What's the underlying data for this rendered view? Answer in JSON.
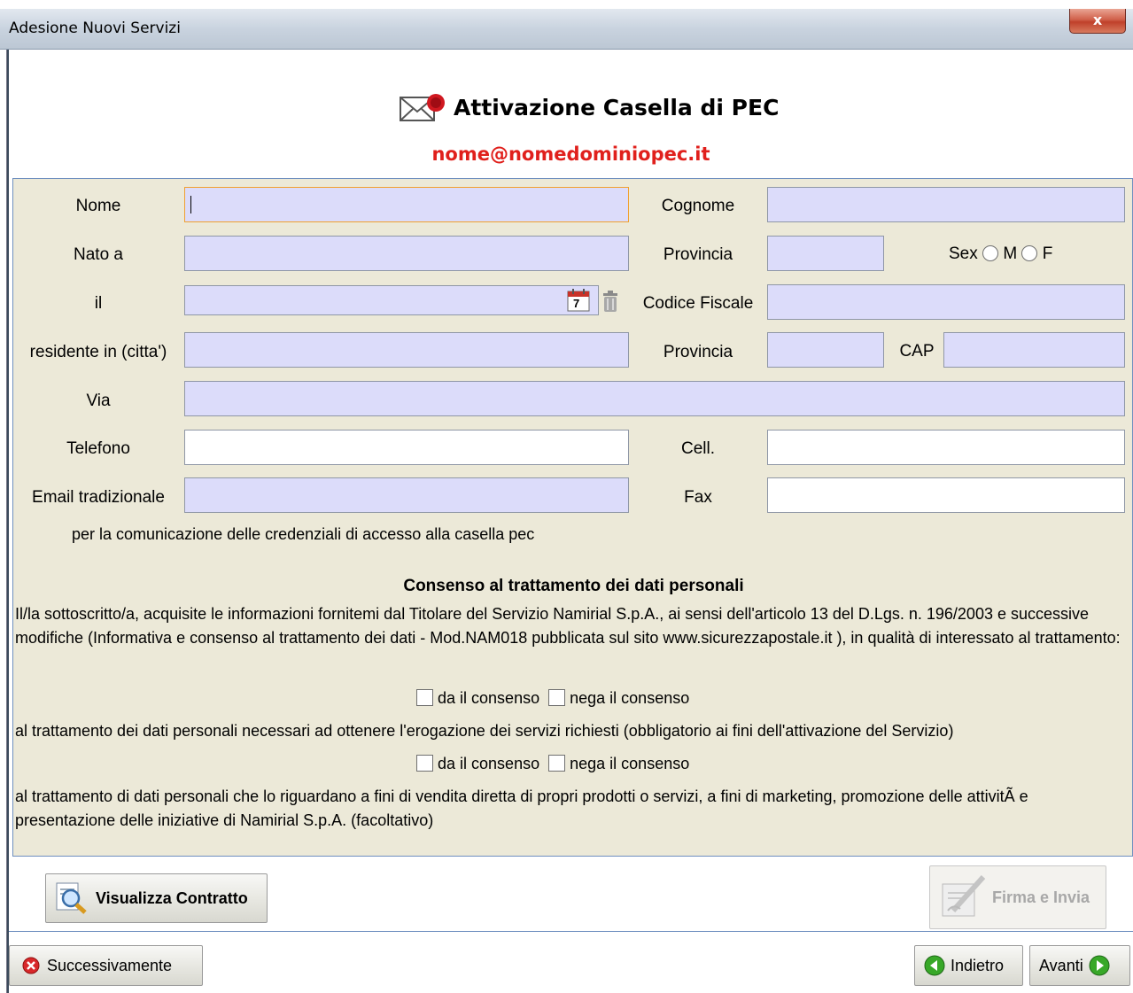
{
  "window": {
    "title": "Adesione Nuovi Servizi",
    "close_glyph": "x"
  },
  "header": {
    "title": "Attivazione Casella di PEC",
    "email": "nome@nomedominiopec.it",
    "icon": "mail-seal-icon"
  },
  "form": {
    "nome_label": "Nome",
    "nome_value": "",
    "cognome_label": "Cognome",
    "nato_label": "Nato a",
    "provincia1_label": "Provincia",
    "sex_label": "Sex",
    "sex_m": "M",
    "sex_f": "F",
    "il_label": "il",
    "calendar_day": "7",
    "codice_fiscale_label": "Codice Fiscale",
    "residente_label": "residente in (citta')",
    "provincia2_label": "Provincia",
    "cap_label": "CAP",
    "via_label": "Via",
    "telefono_label": "Telefono",
    "cell_label": "Cell.",
    "email_label": "Email tradizionale",
    "fax_label": "Fax",
    "email_note": "per la comunicazione delle credenziali di accesso alla casella pec"
  },
  "consent": {
    "heading": "Consenso al trattamento dei dati personali",
    "intro": "Il/la sottoscritto/a, acquisite le informazioni fornitemi dal Titolare del Servizio Namirial S.p.A., ai sensi dell'articolo 13 del D.Lgs. n. 196/2003 e successive modifiche (Informativa e consenso al trattamento dei dati - Mod.NAM018 pubblicata sul sito www.sicurezzapostale.it ), in qualità di interessato al trattamento:",
    "give1": "da il consenso",
    "deny1": "nega il consenso",
    "text1": "al trattamento dei dati personali necessari ad ottenere l'erogazione dei servizi richiesti (obbligatorio ai fini dell'attivazione del Servizio)",
    "give2": "da il consenso",
    "deny2": "nega il consenso",
    "text2": "al trattamento di dati personali che lo riguardano a fini di vendita diretta di propri prodotti o servizi, a fini di marketing, promozione delle attivitÃ  e presentazione delle iniziative di Namirial S.p.A. (facoltativo)"
  },
  "buttons": {
    "view_contract": "Visualizza Contratto",
    "sign_send": "Firma e Invia",
    "later": "Successivamente",
    "back": "Indietro",
    "next": "Avanti"
  },
  "colors": {
    "accent_red": "#e0201c",
    "field_bg": "#dcdcfa",
    "panel_bg": "#ece9d8"
  }
}
